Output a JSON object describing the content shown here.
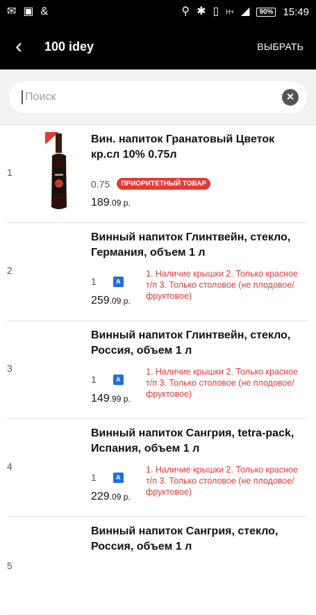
{
  "statusbar": {
    "time": "15:49",
    "battery": "90%",
    "network": "H+"
  },
  "appbar": {
    "back": "‹",
    "title": "100 idey",
    "action": "ВЫБРАТЬ"
  },
  "search": {
    "placeholder": "Поиск",
    "value": ""
  },
  "items": [
    {
      "num": "1",
      "name": "Вин. напиток Гранатовый Цветок кр.сл 10% 0.75л",
      "qty": "0.75",
      "badge": "ПРИОРИТЕТНЫЙ ТОВАР",
      "note": "",
      "rub": "189",
      "kop": ".09 р."
    },
    {
      "num": "2",
      "name": "Винный напиток Глинтвейн, стекло, Германия, объем 1 л",
      "qty": "1",
      "badge": "А",
      "note": "1. Наличие крышки 2. Только красное т/п 3. Только столовое (не плодовое/фруктовое)",
      "rub": "259",
      "kop": ".09 р."
    },
    {
      "num": "3",
      "name": "Винный напиток Глинтвейн, стекло, Россия, объем 1 л",
      "qty": "1",
      "badge": "А",
      "note": "1. Наличие крышки 2. Только красное т/п 3. Только столовое (не плодовое/фруктовое)",
      "rub": "149",
      "kop": ".99 р."
    },
    {
      "num": "4",
      "name": "Винный напиток Сангрия, tetra-pack, Испания, объем 1 л",
      "qty": "1",
      "badge": "А",
      "note": "1. Наличие крышки 2. Только красное т/п 3. Только столовое (не плодовое/фруктовое)",
      "rub": "229",
      "kop": ".09 р."
    },
    {
      "num": "5",
      "name": "Винный напиток Сангрия, стекло, Россия, объем 1 л",
      "qty": "",
      "badge": "",
      "note": "",
      "rub": "",
      "kop": ""
    }
  ]
}
